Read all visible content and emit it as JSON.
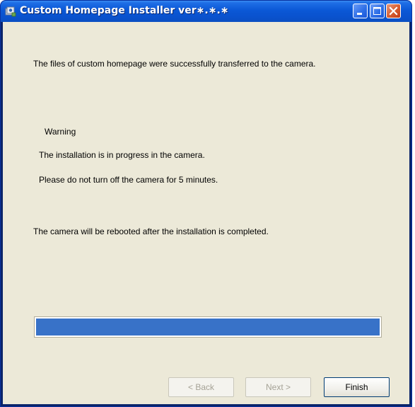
{
  "window": {
    "title": "Custom Homepage Installer  ver∗.∗.∗"
  },
  "titlebar_buttons": {
    "minimize_icon": "minimize-icon",
    "maximize_icon": "maximize-icon",
    "close_icon": "close-icon"
  },
  "messages": {
    "success": "The files of custom homepage were successfully transferred to the camera.",
    "warning_heading": "Warning",
    "warning_line1": "The installation is in progress in the camera.",
    "warning_line2": "Please do not turn off the camera for 5 minutes.",
    "reboot_notice": "The camera will be rebooted after the installation is completed."
  },
  "progress": {
    "fraction": 1.0
  },
  "buttons": {
    "back": "< Back",
    "next": "Next >",
    "finish": "Finish"
  },
  "colors": {
    "titlebar": "#0b58d6",
    "client_bg": "#ece9d8",
    "progress_fill": "#3872c8"
  }
}
